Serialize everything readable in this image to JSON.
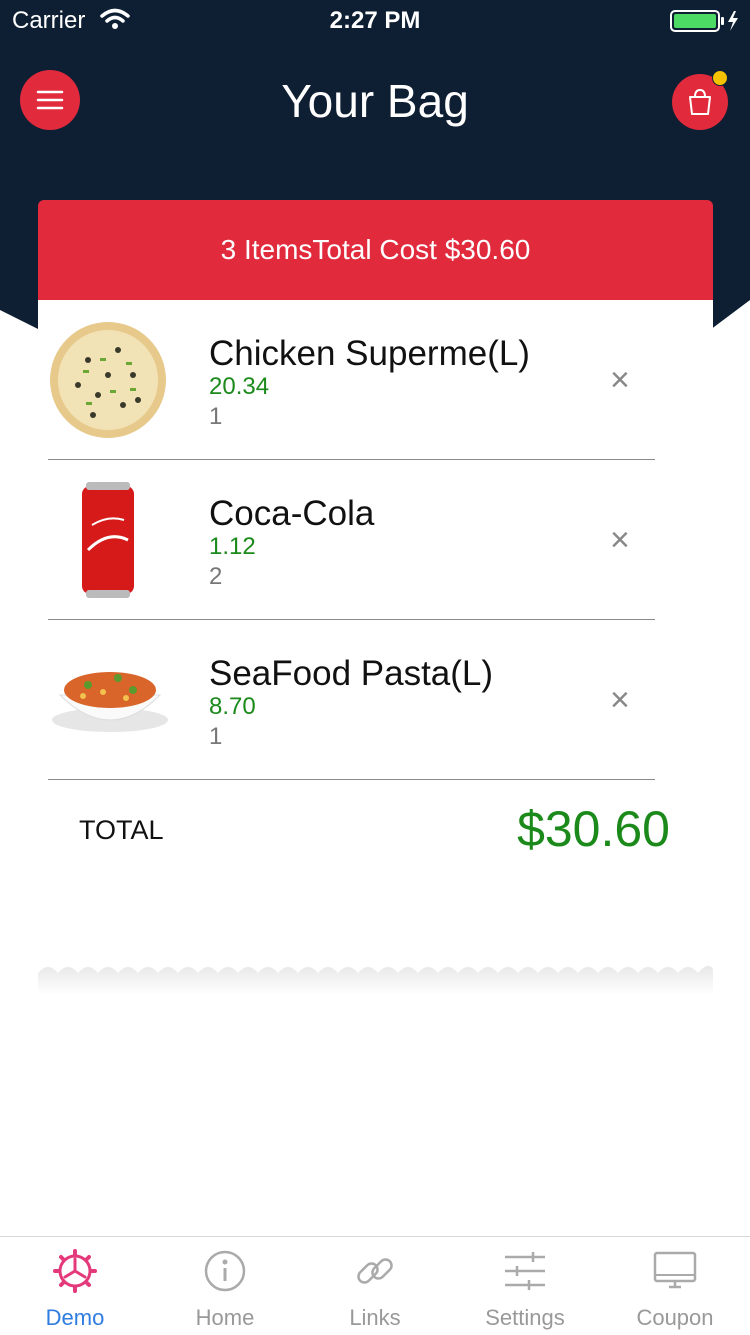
{
  "status_bar": {
    "carrier": "Carrier",
    "time": "2:27 PM"
  },
  "header": {
    "title": "Your Bag",
    "menu_icon": "menu-icon",
    "bag_icon": "shopping-bag-icon",
    "accent": "#e12a3c",
    "background": "#0f1f33"
  },
  "summary": {
    "text": "3 ItemsTotal Cost $30.60"
  },
  "items": [
    {
      "name": "Chicken Superme(L)",
      "price": "20.34",
      "qty": "1",
      "image": "pizza"
    },
    {
      "name": "Coca-Cola",
      "price": "1.12",
      "qty": "2",
      "image": "cola-can"
    },
    {
      "name": "SeaFood Pasta(L)",
      "price": "8.70",
      "qty": "1",
      "image": "pasta-bowl"
    }
  ],
  "remove_symbol": "×",
  "total": {
    "label": "TOTAL",
    "value": "$30.60"
  },
  "tabs": [
    {
      "label": "Demo",
      "icon": "demo-gear-icon",
      "active": true
    },
    {
      "label": "Home",
      "icon": "info-icon",
      "active": false
    },
    {
      "label": "Links",
      "icon": "link-icon",
      "active": false
    },
    {
      "label": "Settings",
      "icon": "sliders-icon",
      "active": false
    },
    {
      "label": "Coupon",
      "icon": "monitor-icon",
      "active": false
    }
  ]
}
